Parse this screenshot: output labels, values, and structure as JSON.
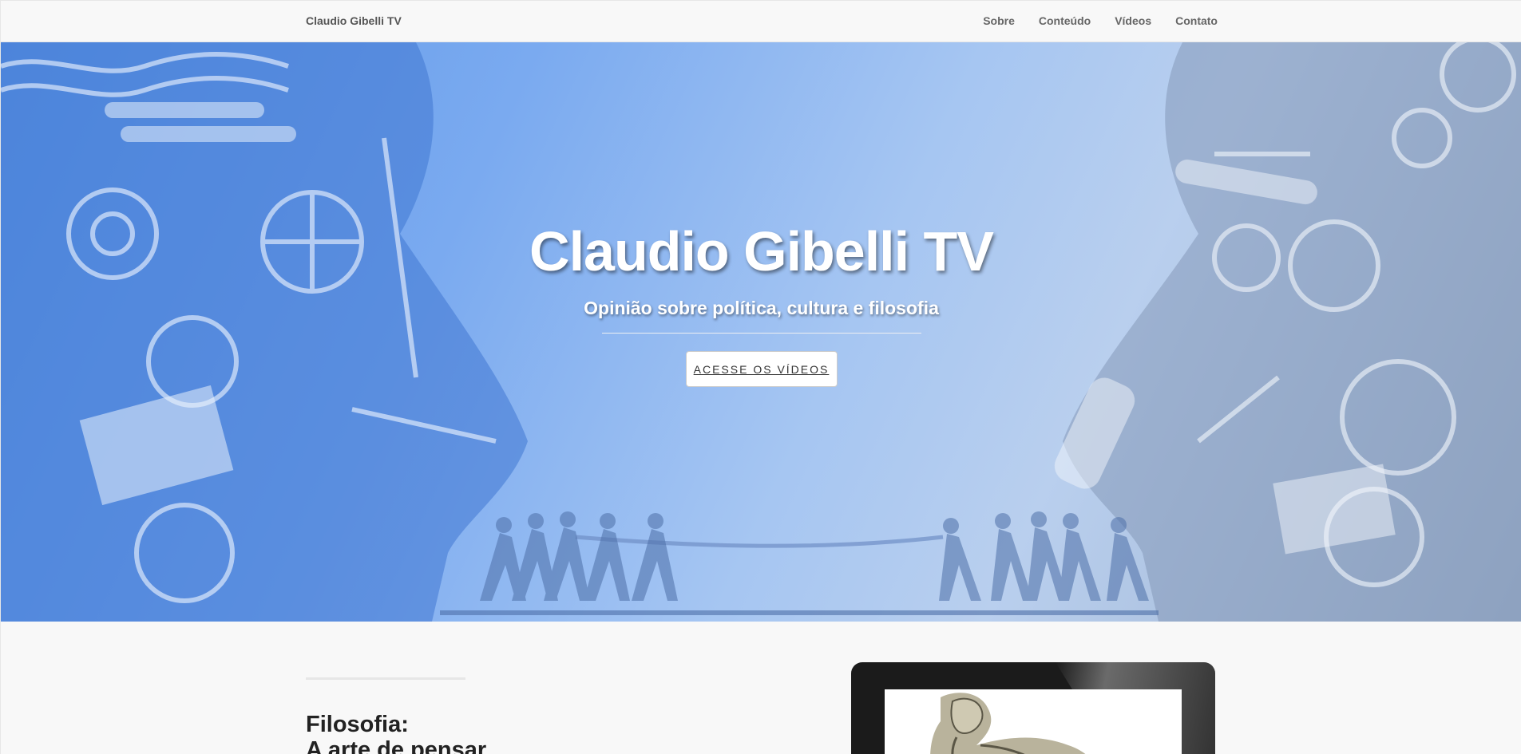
{
  "nav": {
    "brand": "Claudio Gibelli TV",
    "links": [
      "Sobre",
      "Conteúdo",
      "Vídeos",
      "Contato"
    ]
  },
  "hero": {
    "title": "Claudio Gibelli TV",
    "subtitle": "Opinião sobre política, cultura e filosofia",
    "button": "Acesse os vídeos",
    "background_image": "mechanical-heads-tug-of-war-illustration"
  },
  "section": {
    "heading_line1": "Filosofia:",
    "heading_line2": "A arte de pensar",
    "image": "thinker-statue-on-tablet"
  },
  "colors": {
    "hero_blue": "#5c96e6",
    "navbar_bg": "#f8f8f8",
    "text_dark": "#222222"
  }
}
